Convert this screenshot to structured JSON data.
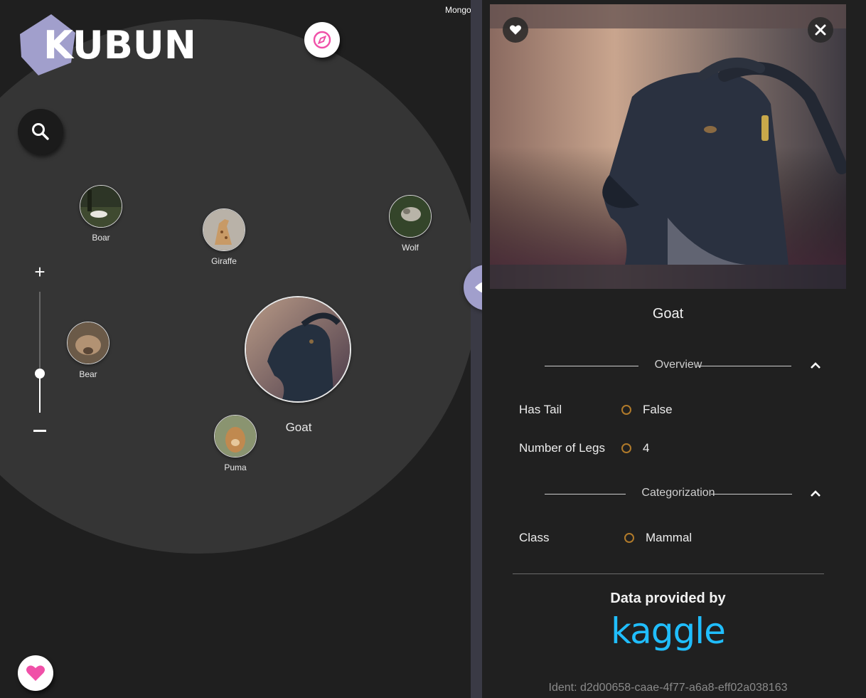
{
  "app": {
    "logo_text": "KUBUN",
    "brand_color": "#a19fcc",
    "accent_pink": "#f050a8"
  },
  "explorer": {
    "offscreen_label": "Mongoose",
    "nodes": [
      {
        "label": "Boar",
        "image": "boar-photo"
      },
      {
        "label": "Giraffe",
        "image": "giraffe-photo"
      },
      {
        "label": "Wolf",
        "image": "wolf-photo"
      },
      {
        "label": "Bear",
        "image": "bear-photo"
      },
      {
        "label": "Goat",
        "image": "goat-photo",
        "selected": true
      },
      {
        "label": "Puma",
        "image": "puma-photo"
      }
    ],
    "zoom": {
      "plus": "+",
      "minus": "−",
      "level_fraction": 0.3
    }
  },
  "detail": {
    "title": "Goat",
    "sections": [
      {
        "title": "Overview",
        "expanded": true,
        "properties": [
          {
            "key": "Has Tail",
            "value": "False"
          },
          {
            "key": "Number of Legs",
            "value": "4"
          }
        ]
      },
      {
        "title": "Categorization",
        "expanded": true,
        "properties": [
          {
            "key": "Class",
            "value": "Mammal"
          }
        ]
      }
    ],
    "provider_heading": "Data provided by",
    "provider_logo": "kaggle",
    "ident": "Ident: d2d00658-caae-4f77-a6a8-eff02a038163"
  },
  "icons": {
    "compass": "compass-icon",
    "search": "search-icon",
    "favorite": "heart-icon",
    "eye": "eye-icon",
    "close": "close-icon",
    "collapse": "chevron-up-icon"
  }
}
